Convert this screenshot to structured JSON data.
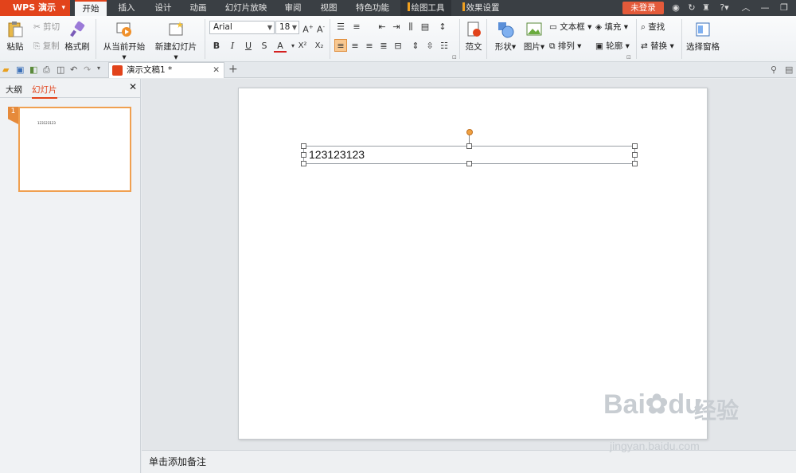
{
  "app": {
    "name": "WPS 演示"
  },
  "menu_tabs": [
    {
      "label": "开始"
    },
    {
      "label": "插入"
    },
    {
      "label": "设计"
    },
    {
      "label": "动画"
    },
    {
      "label": "幻灯片放映"
    },
    {
      "label": "审阅"
    },
    {
      "label": "视图"
    },
    {
      "label": "特色功能"
    },
    {
      "label": "绘图工具"
    },
    {
      "label": "效果设置"
    }
  ],
  "login_label": "未登录",
  "ribbon": {
    "paste": "粘贴",
    "cut": "剪切",
    "copy": "复制",
    "format_painter": "格式刷",
    "from_current": "从当前开始",
    "new_slide": "新建幻灯片",
    "font_name": "Arial",
    "font_size": "18",
    "bold": "B",
    "italic": "I",
    "underline": "U",
    "strike": "S",
    "font_color": "A",
    "superscript": "X²",
    "subscript": "X₂",
    "template": "范文",
    "shape": "形状",
    "picture": "图片",
    "textbox": "文本框",
    "arrange": "排列",
    "fill": "填充",
    "outline": "轮廓",
    "find": "查找",
    "replace": "替换",
    "selection_pane": "选择窗格"
  },
  "doc_tab": {
    "title": "演示文稿1 *"
  },
  "left_panel": {
    "tab_outline": "大纲",
    "tab_slides": "幻灯片",
    "slide_number": "1",
    "thumb_text": "123123123"
  },
  "slide": {
    "text": "123123123"
  },
  "notes": {
    "placeholder": "单击添加备注"
  },
  "watermark": {
    "brand": "Bai",
    "brand2": "du",
    "cn": "经验",
    "url": "jingyan.baidu.com"
  },
  "colors": {
    "accent": "#e2431b",
    "titlebar": "#3a3f44",
    "tab_marker": "#f0a020"
  }
}
